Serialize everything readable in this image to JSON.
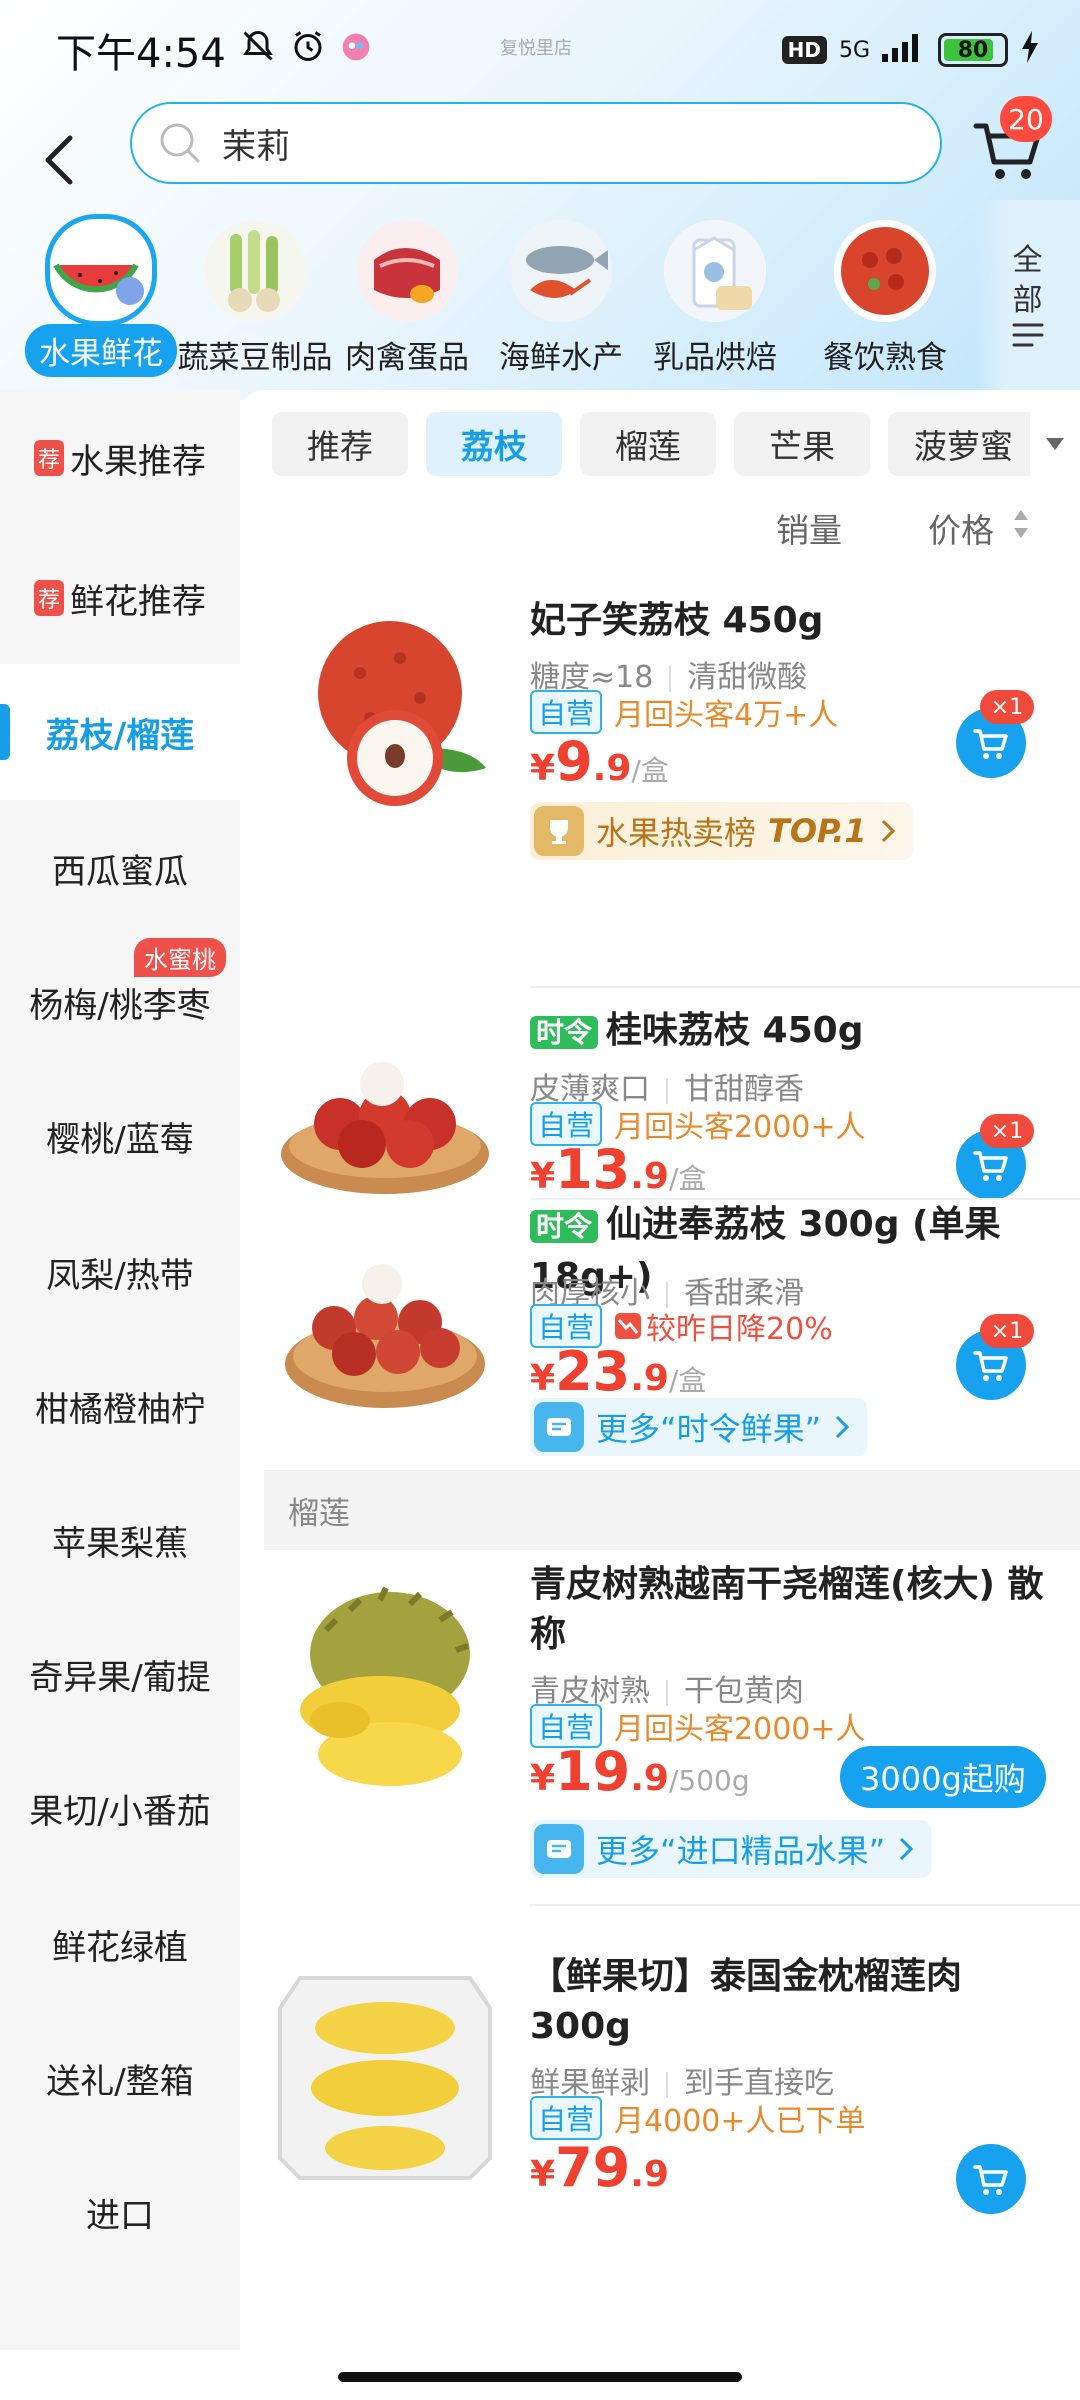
{
  "status_bar": {
    "time": "下午4:54",
    "network": "5G",
    "hd": "HD",
    "battery": "80",
    "center_text": "复悦里店"
  },
  "header": {
    "search_value": "茉莉",
    "cart_count": "20"
  },
  "categories": [
    {
      "label": "水果鲜花",
      "active": true
    },
    {
      "label": "蔬菜豆制品"
    },
    {
      "label": "肉禽蛋品"
    },
    {
      "label": "海鲜水产"
    },
    {
      "label": "乳品烘焙"
    },
    {
      "label": "餐饮熟食"
    }
  ],
  "all_button": {
    "line1": "全",
    "line2": "部"
  },
  "sidebar": {
    "items": [
      {
        "label": "水果推荐",
        "tag": "荐"
      },
      {
        "label": "鲜花推荐",
        "tag": "荐"
      },
      {
        "label": "荔枝/榴莲",
        "active": true
      },
      {
        "label": "西瓜蜜瓜"
      },
      {
        "label": "杨梅/桃李枣",
        "badge": "水蜜桃"
      },
      {
        "label": "樱桃/蓝莓"
      },
      {
        "label": "凤梨/热带"
      },
      {
        "label": "柑橘橙柚柠"
      },
      {
        "label": "苹果梨蕉"
      },
      {
        "label": "奇异果/葡提"
      },
      {
        "label": "果切/小番茄"
      },
      {
        "label": "鲜花绿植"
      },
      {
        "label": "送礼/整箱"
      },
      {
        "label": "进口"
      }
    ]
  },
  "sub_tabs": [
    "推荐",
    "荔枝",
    "榴莲",
    "芒果",
    "菠萝蜜"
  ],
  "sort": {
    "sales": "销量",
    "price": "价格"
  },
  "products": [
    {
      "title": "妃子笑荔枝 450g",
      "sub1": "糖度≈18",
      "sub2": "清甜微酸",
      "tag_self": "自营",
      "tag_text": "月回头客4万+人",
      "yen": "¥",
      "price_int": "9",
      "price_dec": ".9",
      "unit": "/盒",
      "cart_badge": "×1",
      "rank_text": "水果热卖榜",
      "rank_top": "TOP.1"
    },
    {
      "time_tag": "时令",
      "title": "桂味荔枝 450g",
      "sub1": "皮薄爽口",
      "sub2": "甘甜醇香",
      "tag_self": "自营",
      "tag_text": "月回头客2000+人",
      "yen": "¥",
      "price_int": "13",
      "price_dec": ".9",
      "unit": "/盒",
      "cart_badge": "×1"
    },
    {
      "time_tag": "时令",
      "title": "仙进奉荔枝 300g (单果18g+)",
      "sub1": "肉厚核小",
      "sub2": "香甜柔滑",
      "tag_self": "自营",
      "tag_down": "较昨日降20%",
      "yen": "¥",
      "price_int": "23",
      "price_dec": ".9",
      "unit": "/盒",
      "cart_badge": "×1",
      "more_text": "更多“时令鲜果”"
    },
    {
      "title": "青皮树熟越南干尧榴莲(核大) 散称",
      "sub1": "青皮树熟",
      "sub2": "干包黄肉",
      "tag_self": "自营",
      "tag_text": "月回头客2000+人",
      "yen": "¥",
      "price_int": "19",
      "price_dec": ".9",
      "unit": "/500g",
      "qty_button": "3000g起购",
      "more_text": "更多“进口精品水果”"
    },
    {
      "title": "【鲜果切】泰国金枕榴莲肉300g",
      "sub1": "鲜果鲜剥",
      "sub2": "到手直接吃",
      "tag_self": "自营",
      "tag_text": "月4000+人已下单",
      "yen": "¥",
      "price_int": "79",
      "price_dec": ".9"
    }
  ],
  "section_durian": "榴莲",
  "colors": {
    "accent": "#16a2ee",
    "price": "#f04030",
    "tag_orange": "#e88a2c"
  }
}
